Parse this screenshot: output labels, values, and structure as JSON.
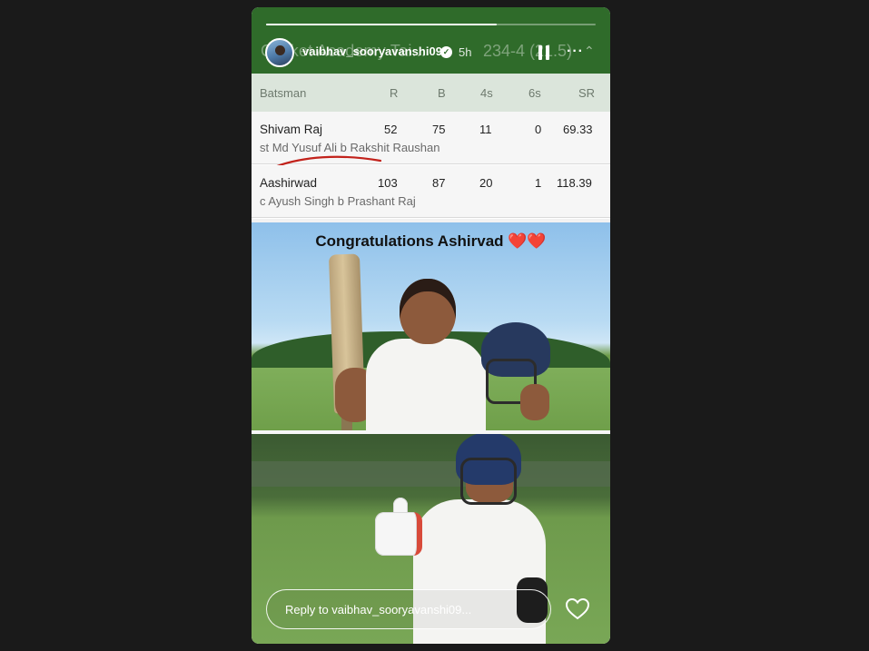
{
  "story": {
    "progress": 0.7,
    "user": {
      "username": "vaibhav_sooryavanshi09",
      "age": "5h"
    },
    "background_header": {
      "title": "Cricket Academy Tai...",
      "score": "234-4 (21.5)"
    },
    "reply_placeholder": "Reply to vaibhav_sooryavanshi09...",
    "icons": [
      "verified-badge-icon",
      "pause-icon",
      "more-icon",
      "heart-icon",
      "chevron-up-icon"
    ]
  },
  "scorecard": {
    "headers": [
      "Batsman",
      "R",
      "B",
      "4s",
      "6s",
      "SR"
    ],
    "rows": [
      {
        "name": "Shivam Raj",
        "r": "52",
        "b": "75",
        "fours": "11",
        "sixes": "0",
        "sr": "69.33",
        "dismissal": "st Md Yusuf Ali b Rakshit Raushan"
      },
      {
        "name": "Aashirwad",
        "r": "103",
        "b": "87",
        "fours": "20",
        "sixes": "1",
        "sr": "118.39",
        "dismissal": "c Ayush Singh b Prashant Raj"
      }
    ]
  },
  "caption": "Congratulations Ashirvad ❤️❤️",
  "colors": {
    "header_green": "#2f6b2a",
    "table_head": "#dbe5db",
    "ink_red": "#c2221b"
  }
}
